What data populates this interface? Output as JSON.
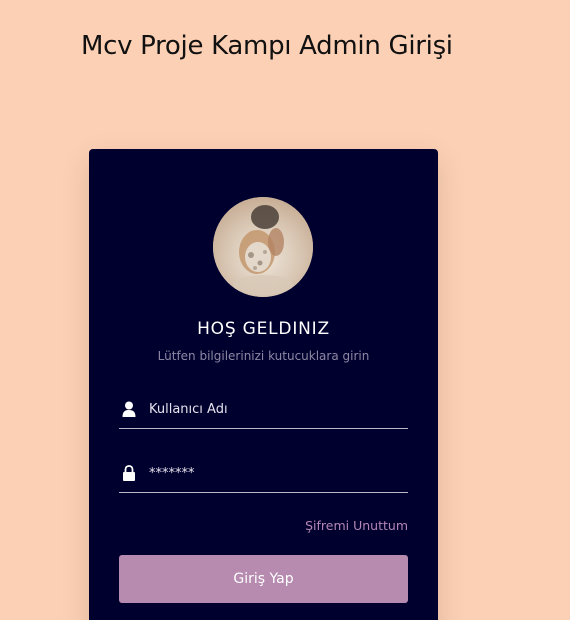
{
  "page": {
    "title": "Mcv Proje Kampı Admin Girişi"
  },
  "login_card": {
    "welcome": "HOŞ GELDINIZ",
    "subtitle": "Lütfen bilgilerinizi kutucuklara girin",
    "username": {
      "placeholder": "Kullanıcı Adı",
      "value": "",
      "icon": "user-icon"
    },
    "password": {
      "placeholder": "*******",
      "value": "",
      "icon": "lock-icon"
    },
    "forgot_link": "Şifremi Unuttum",
    "submit_label": "Giriş Yap"
  },
  "colors": {
    "background": "#FCD0B4",
    "card": "#00002E",
    "accent": "#B78AB0",
    "link": "#B486B5"
  }
}
